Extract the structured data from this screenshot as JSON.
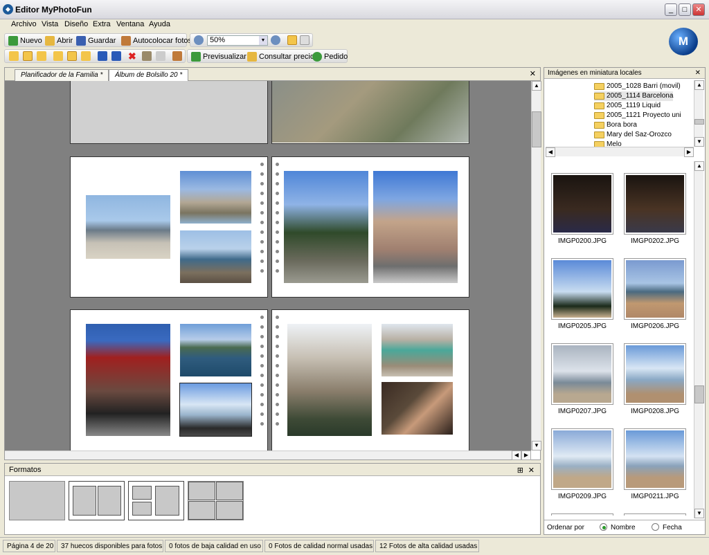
{
  "app": {
    "title": "Editor MyPhotoFun",
    "logo_text": "M"
  },
  "menu": [
    "Archivo",
    "Vista",
    "Diseño",
    "Extra",
    "Ventana",
    "Ayuda"
  ],
  "toolbar1": {
    "new": "Nuevo",
    "open": "Abrir",
    "save": "Guardar",
    "autoplace": "Autocolocar fotos",
    "zoom": "50%"
  },
  "toolbar2": {
    "preview": "Previsualizar",
    "price": "Consultar precio",
    "order": "Pedido"
  },
  "tabs": [
    "Planificador de la Familia *",
    "Álbum de Bolsillo 20 *"
  ],
  "formats": {
    "title": "Formatos"
  },
  "right": {
    "title": "Imágenes en miniatura locales",
    "folders": [
      "2005_1028 Barri (movil)",
      "2005_1114 Barcelona",
      "2005_1119 Liquid",
      "2005_1121 Proyecto uni",
      "Bora bora",
      "Mary del Saz-Orozco",
      "Melo"
    ],
    "thumbs": [
      "IMGP0200.JPG",
      "IMGP0202.JPG",
      "IMGP0205.JPG",
      "IMGP0206.JPG",
      "IMGP0207.JPG",
      "IMGP0208.JPG",
      "IMGP0209.JPG",
      "IMGP0211.JPG"
    ],
    "sort_label": "Ordenar por",
    "sort_name": "Nombre",
    "sort_date": "Fecha"
  },
  "status": [
    "Página 4 de 20",
    "37 huecos disponibles para fotos",
    "0 fotos de baja calidad en uso",
    "0 Fotos de calidad normal usadas",
    "12 Fotos de alta calidad usadas"
  ]
}
